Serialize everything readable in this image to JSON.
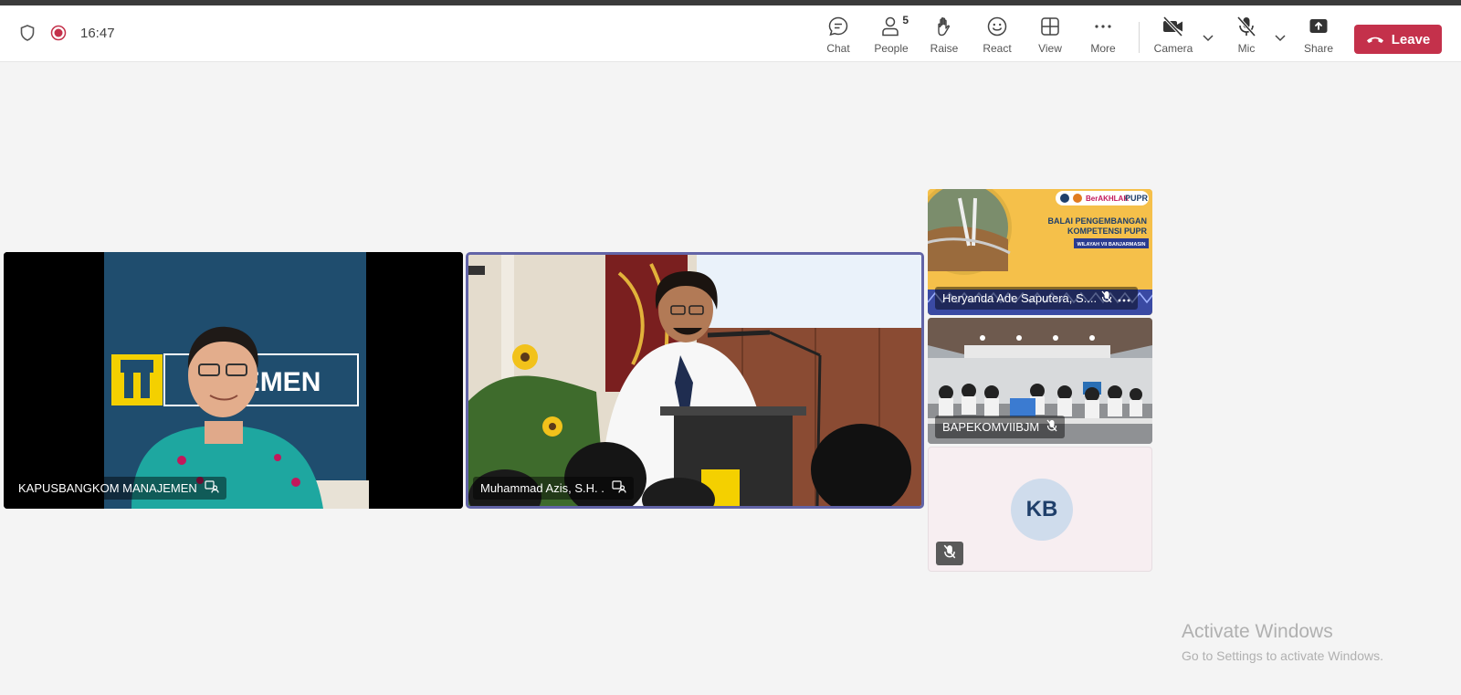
{
  "toolbar": {
    "time": "16:47",
    "buttons": {
      "chat": "Chat",
      "people": "People",
      "people_count": "5",
      "raise": "Raise",
      "react": "React",
      "view": "View",
      "more": "More",
      "camera": "Camera",
      "mic": "Mic",
      "share": "Share"
    },
    "leave_label": "Leave",
    "leave_color": "#c4314b"
  },
  "icons": [
    "shield-icon",
    "recording-icon",
    "chat-icon",
    "people-icon",
    "raise-hand-icon",
    "react-icon",
    "view-icon",
    "more-icon",
    "camera-off-icon",
    "mic-off-icon",
    "share-icon",
    "phone-icon"
  ],
  "tiles": {
    "tile1": {
      "name": "KAPUSBANGKOM MANAJEMEN",
      "banner_text": "JEMEN"
    },
    "tile2": {
      "name": "Muhammad Azis, S.H. ."
    },
    "tile3": {
      "name": "Heryanda Ade Saputera, S....",
      "banner_line1": "BALAI PENGEMBANGAN",
      "banner_line2": "KOMPETENSI PUPR",
      "banner_line3": "WILAYAH VII BANJARMASIN",
      "logo_text": "BerAKHLAK",
      "pupr_text": "PUPR"
    },
    "tile4": {
      "name": "BAPEKOMVIIBJM"
    },
    "tile5": {
      "initials": "KB"
    }
  },
  "active_speaker_color": "#6264a7",
  "watermark": {
    "line1": "Activate Windows",
    "line2": "Go to Settings to activate Windows."
  }
}
